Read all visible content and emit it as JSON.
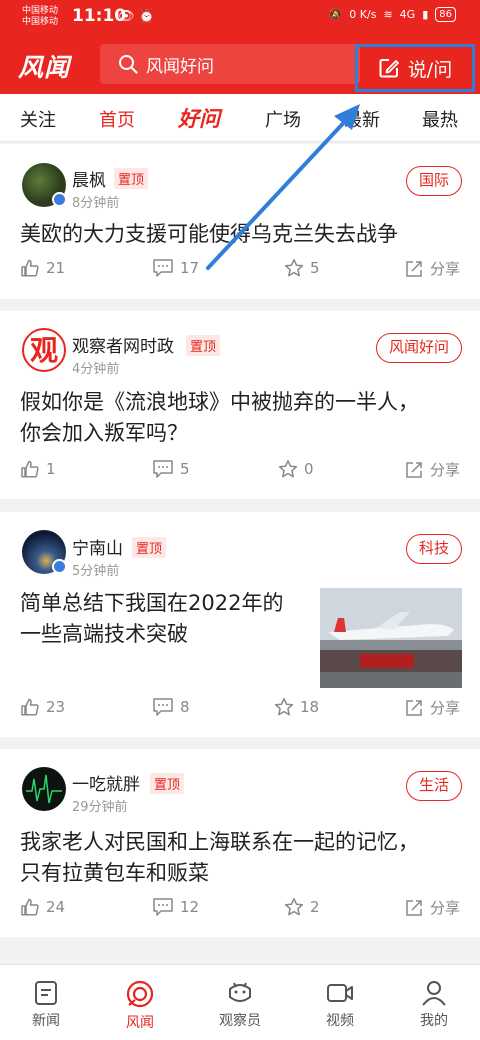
{
  "status_bar": {
    "carrier_1": "中国移动",
    "carrier_2": "中国移动",
    "time": "11:10",
    "speed": "0 K/s",
    "network": "4G",
    "battery": "86"
  },
  "header": {
    "logo": "风闻",
    "search_placeholder": "风闻好问",
    "ask_button": "说/问"
  },
  "tabs": [
    {
      "label": "关注"
    },
    {
      "label": "首页"
    },
    {
      "label": "好问"
    },
    {
      "label": "广场"
    },
    {
      "label": "最新"
    },
    {
      "label": "最热"
    }
  ],
  "posts": [
    {
      "author": "晨枫",
      "pin": "置顶",
      "time": "8分钟前",
      "category": "国际",
      "title_lines": [
        "美欧的大力支援可能使得乌克兰失去战争",
        ""
      ],
      "likes": "21",
      "comments": "17",
      "stars": "5",
      "share": "分享"
    },
    {
      "author": "观察者网时政",
      "pin": "置顶",
      "time": "4分钟前",
      "category": "风闻好问",
      "title_lines": [
        "假如你是《流浪地球》中被抛弃的一半人，",
        "你会加入叛军吗？"
      ],
      "likes": "1",
      "comments": "5",
      "stars": "0",
      "share": "分享"
    },
    {
      "author": "宁南山",
      "pin": "置顶",
      "time": "5分钟前",
      "category": "科技",
      "title_lines": [
        "简单总结下我国在2022年的",
        "一些高端技术突破"
      ],
      "likes": "23",
      "comments": "8",
      "stars": "18",
      "share": "分享"
    },
    {
      "author": "一吃就胖",
      "pin": "置顶",
      "time": "29分钟前",
      "category": "生活",
      "title_lines": [
        "我家老人对民国和上海联系在一起的记忆，",
        "只有拉黄包车和贩菜"
      ],
      "likes": "24",
      "comments": "12",
      "stars": "2",
      "share": "分享"
    }
  ],
  "bottom_nav": [
    {
      "label": "新闻",
      "icon": "news-icon"
    },
    {
      "label": "风闻",
      "icon": "fengwen-icon"
    },
    {
      "label": "观察员",
      "icon": "observer-icon"
    },
    {
      "label": "视频",
      "icon": "video-icon"
    },
    {
      "label": "我的",
      "icon": "profile-icon"
    }
  ],
  "colors": {
    "brand_red": "#e8251f",
    "annotation_blue": "#2f7fd9"
  }
}
